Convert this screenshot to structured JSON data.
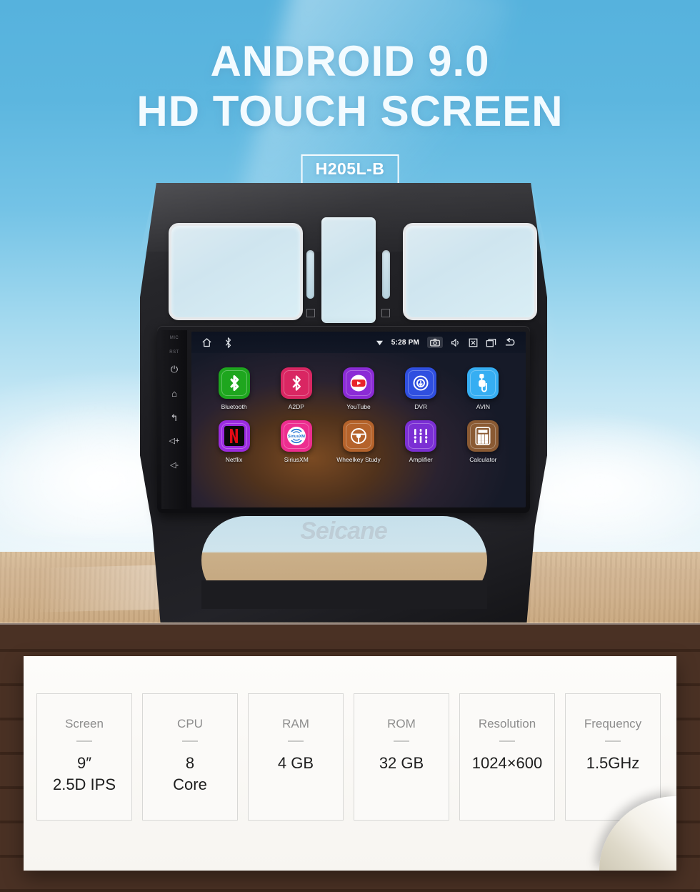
{
  "header": {
    "line1": "ANDROID 9.0",
    "line2": "HD TOUCH SCREEN",
    "model_badge": "H205L-B"
  },
  "brand": {
    "watermark": "Seicane"
  },
  "device": {
    "side_rail": {
      "labels": [
        "MIC",
        "RST"
      ],
      "buttons": [
        {
          "name": "power-button",
          "glyph": "⏻"
        },
        {
          "name": "home-button",
          "glyph": "⌂"
        },
        {
          "name": "back-button",
          "glyph": "↰"
        },
        {
          "name": "volume-up-button",
          "glyph": "◁+"
        },
        {
          "name": "volume-down-button",
          "glyph": "◁-"
        }
      ]
    },
    "statusbar": {
      "time": "5:28 PM",
      "left_icons": [
        "home-icon",
        "bluetooth-icon"
      ],
      "right_icons": [
        "wifi-icon",
        "camera-icon",
        "volume-icon",
        "close-icon",
        "recents-icon",
        "back-icon"
      ]
    },
    "apps": [
      {
        "label": "Bluetooth",
        "icon": "bluetooth-icon",
        "bg": "#1EA61E",
        "fg": "#ffffff"
      },
      {
        "label": "A2DP",
        "icon": "a2dp-icon",
        "bg": "#D92662",
        "fg": "#ffffff"
      },
      {
        "label": "YouTube",
        "icon": "youtube-icon",
        "bg": "#8B2BD6",
        "fg": "#ffffff"
      },
      {
        "label": "DVR",
        "icon": "dvr-icon",
        "bg": "#2F4FE0",
        "fg": "#ffffff"
      },
      {
        "label": "AVIN",
        "icon": "avin-icon",
        "bg": "#36AEF2",
        "fg": "#ffffff"
      },
      {
        "label": "Netflix",
        "icon": "netflix-icon",
        "bg": "#9B2BE0",
        "fg": "#E50914"
      },
      {
        "label": "SiriusXM",
        "icon": "siriusxm-icon",
        "bg": "#ED2D8F",
        "fg": "#ffffff"
      },
      {
        "label": "Wheelkey Study",
        "icon": "steering-wheel-icon",
        "bg": "#B5632B",
        "fg": "#ffffff"
      },
      {
        "label": "Amplifier",
        "icon": "equalizer-icon",
        "bg": "#7B2FD4",
        "fg": "#ffffff"
      },
      {
        "label": "Calculator",
        "icon": "calculator-icon",
        "bg": "#8A5A33",
        "fg": "#ffffff"
      }
    ]
  },
  "specs": [
    {
      "key": "Screen",
      "value": "9″\n2.5D IPS"
    },
    {
      "key": "CPU",
      "value": "8\nCore"
    },
    {
      "key": "RAM",
      "value": "4 GB"
    },
    {
      "key": "ROM",
      "value": "32 GB"
    },
    {
      "key": "Resolution",
      "value": "1024×600"
    },
    {
      "key": "Frequency",
      "value": "1.5GHz"
    }
  ],
  "colors": {
    "sky": "#56b2dd",
    "table": "#d3b694",
    "wood_dark": "#4a3124",
    "card": "#fbfaf8"
  }
}
